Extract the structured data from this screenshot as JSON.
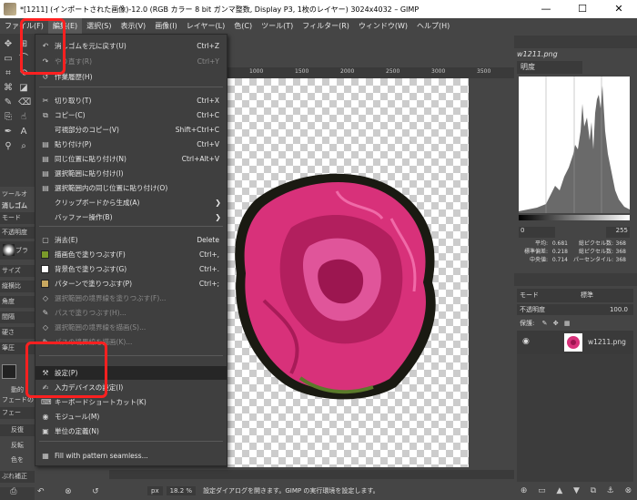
{
  "window": {
    "title": "*[1211] (インポートされた画像)-12.0 (RGB カラー 8 bit ガンマ整数, Display P3, 1枚のレイヤー) 3024x4032 – GIMP",
    "minimize": "—",
    "maximize": "☐",
    "close": "✕"
  },
  "menubar": [
    {
      "label": "ファイル(F)"
    },
    {
      "label": "編集(E)"
    },
    {
      "label": "選択(S)"
    },
    {
      "label": "表示(V)"
    },
    {
      "label": "画像(I)"
    },
    {
      "label": "レイヤー(L)"
    },
    {
      "label": "色(C)"
    },
    {
      "label": "ツール(T)"
    },
    {
      "label": "フィルター(R)"
    },
    {
      "label": "ウィンドウ(W)"
    },
    {
      "label": "ヘルプ(H)"
    }
  ],
  "edit_menu": [
    {
      "label": "消しゴムを元に戻す(U)",
      "shortcut": "Ctrl+Z",
      "icon": "undo-icon",
      "glyph": "↶",
      "disabled": false
    },
    {
      "label": "やり直す(R)",
      "shortcut": "Ctrl+Y",
      "icon": "redo-icon",
      "glyph": "↷",
      "disabled": true
    },
    {
      "label": "作業履歴(H)",
      "shortcut": "",
      "icon": "history-icon",
      "glyph": "↺",
      "disabled": false
    },
    {
      "label": "切り取り(T)",
      "shortcut": "Ctrl+X",
      "icon": "cut-icon",
      "glyph": "✂",
      "disabled": false
    },
    {
      "label": "コピー(C)",
      "shortcut": "Ctrl+C",
      "icon": "copy-icon",
      "glyph": "⧉",
      "disabled": false
    },
    {
      "label": "可視部分のコピー(V)",
      "shortcut": "Shift+Ctrl+C",
      "icon": "",
      "glyph": "",
      "disabled": false
    },
    {
      "label": "貼り付け(P)",
      "shortcut": "Ctrl+V",
      "icon": "paste-icon",
      "glyph": "▤",
      "disabled": false
    },
    {
      "label": "同じ位置に貼り付け(N)",
      "shortcut": "Ctrl+Alt+V",
      "icon": "paste-in-place-icon",
      "glyph": "▤",
      "disabled": false
    },
    {
      "label": "選択範囲に貼り付け(I)",
      "shortcut": "",
      "icon": "paste-into-icon",
      "glyph": "▤",
      "disabled": false
    },
    {
      "label": "選択範囲内の同じ位置に貼り付け(O)",
      "shortcut": "",
      "icon": "paste-into-in-place-icon",
      "glyph": "▤",
      "disabled": false
    },
    {
      "label": "クリップボードから生成(A)",
      "shortcut": "",
      "icon": "",
      "glyph": "",
      "disabled": false,
      "submenu": true
    },
    {
      "label": "バッファー操作(B)",
      "shortcut": "",
      "icon": "",
      "glyph": "",
      "disabled": false,
      "submenu": true
    },
    {
      "label": "消去(E)",
      "shortcut": "Delete",
      "icon": "clear-icon",
      "glyph": "▢",
      "disabled": false
    },
    {
      "label": "描画色で塗りつぶす(F)",
      "shortcut": "Ctrl+,",
      "icon": "",
      "swatch": "#7a9a2a",
      "disabled": false
    },
    {
      "label": "背景色で塗りつぶす(G)",
      "shortcut": "Ctrl+.",
      "icon": "",
      "swatch": "#ffffff",
      "disabled": false
    },
    {
      "label": "パターンで塗りつぶす(P)",
      "shortcut": "Ctrl+;",
      "icon": "",
      "swatch": "#c8a860",
      "disabled": false
    },
    {
      "label": "選択範囲の境界線を塗りつぶす(F)...",
      "shortcut": "",
      "icon": "fill-selection-outline-icon",
      "glyph": "◇",
      "disabled": true
    },
    {
      "label": "パスで塗りつぶす(H)...",
      "shortcut": "",
      "icon": "fill-path-icon",
      "glyph": "✎",
      "disabled": true
    },
    {
      "label": "選択範囲の境界線を描画(S)...",
      "shortcut": "",
      "icon": "stroke-selection-icon",
      "glyph": "◇",
      "disabled": true
    },
    {
      "label": "パスの境界線を描画(K)...",
      "shortcut": "",
      "icon": "stroke-path-icon",
      "glyph": "✎",
      "disabled": true
    },
    {
      "label": "設定(P)",
      "shortcut": "",
      "icon": "preferences-icon",
      "glyph": "⚒",
      "disabled": false,
      "highlight": true
    },
    {
      "label": "入力デバイスの設定(I)",
      "shortcut": "",
      "icon": "input-devices-icon",
      "glyph": "✍",
      "disabled": false
    },
    {
      "label": "キーボードショートカット(K)",
      "shortcut": "",
      "icon": "keyboard-icon",
      "glyph": "⌨",
      "disabled": false
    },
    {
      "label": "モジュール(M)",
      "shortcut": "",
      "icon": "modules-icon",
      "glyph": "◉",
      "disabled": false
    },
    {
      "label": "単位の定義(N)",
      "shortcut": "",
      "icon": "units-icon",
      "glyph": "▣",
      "disabled": false
    },
    {
      "label": "Fill with pattern seamless...",
      "shortcut": "",
      "icon": "pattern-icon",
      "glyph": "▦",
      "disabled": false
    }
  ],
  "toolbox": {
    "options_title": "ツールオ",
    "tool_name": "消しゴム",
    "mode_label": "モード",
    "opacity_label": "不透明度",
    "brush_label": "ブラ",
    "size_label": "サイズ",
    "ratio_label": "縦横比",
    "angle_label": "角度",
    "spacing_label": "間隔",
    "hardness_label": "硬さ",
    "force_label": "筆圧",
    "dynamics_label": "動的",
    "fade_label": "フェードの",
    "fade_value": "フェー",
    "reverse_label": "反復",
    "reverse2_label": "反転",
    "color_label": "色を",
    "smooth_label": "ぶれ補正"
  },
  "canvas": {
    "ruler_labels": [
      "1000",
      "1500",
      "2000",
      "2500",
      "3000",
      "3500"
    ],
    "unit": "px",
    "zoom": "18.2 %",
    "status_message": "設定ダイアログを開きます。GIMP の実行環境を設定します。"
  },
  "histogram_panel": {
    "title": "w1211.png",
    "channel": "明度",
    "range_min": "0",
    "range_max": "255",
    "stats": [
      {
        "label": "平均:",
        "value": "0.681",
        "label2": "総ピクセル数:",
        "value2": "368"
      },
      {
        "label": "標準偏差:",
        "value": "0.218",
        "label2": "総ピクセル数:",
        "value2": "368"
      },
      {
        "label": "中央値:",
        "value": "0.714",
        "label2": "パーセンタイル:",
        "value2": "368"
      }
    ]
  },
  "layers_panel": {
    "mode_label": "モード",
    "mode_value": "標準",
    "opacity_label": "不透明度",
    "opacity_value": "100.0",
    "lock_label": "保護:",
    "layer_name": "w1211.png"
  }
}
